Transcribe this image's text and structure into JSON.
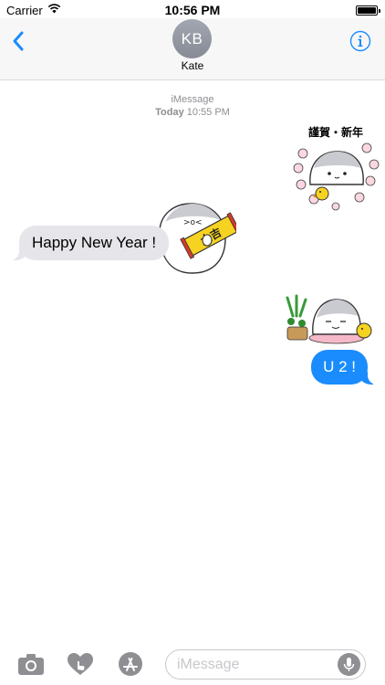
{
  "status_bar": {
    "carrier": "Carrier",
    "time": "10:56 PM",
    "battery_level": 1.0
  },
  "header": {
    "avatar_initials": "KB",
    "contact_name": "Kate",
    "back_icon": "chevron-left-icon",
    "info_icon": "info-icon"
  },
  "conversation": {
    "service": "iMessage",
    "timestamp_day": "Today",
    "timestamp_time": "10:55 PM",
    "messages": [
      {
        "from": "me",
        "type": "sticker",
        "caption": "謹賀・新年"
      },
      {
        "from": "contact",
        "type": "text",
        "text": "Happy New Year !"
      },
      {
        "from": "contact",
        "type": "sticker",
        "caption": "大吉"
      },
      {
        "from": "me",
        "type": "sticker",
        "caption": ""
      },
      {
        "from": "me",
        "type": "text",
        "text": "U 2 !"
      }
    ]
  },
  "input_bar": {
    "placeholder": "iMessage",
    "value": "",
    "tools": [
      "camera-icon",
      "digital-touch-icon",
      "app-store-icon"
    ],
    "mic_icon": "microphone-icon"
  },
  "colors": {
    "accent": "#1a8cfd",
    "incoming_bubble": "#e5e5ea",
    "outgoing_bubble": "#1a8cfd",
    "secondary_text": "#8e8e93"
  }
}
